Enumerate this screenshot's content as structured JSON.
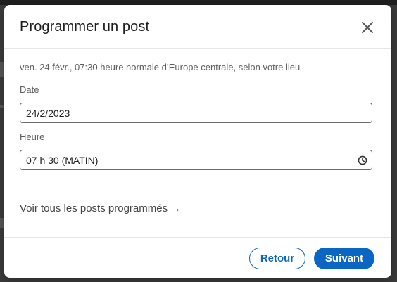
{
  "modal": {
    "title": "Programmer un post",
    "timezone_note": "ven. 24 févr., 07:30 heure normale d’Europe centrale, selon votre lieu",
    "date": {
      "label": "Date",
      "value": "24/2/2023"
    },
    "time": {
      "label": "Heure",
      "value": "07 h 30 (MATIN)"
    },
    "view_scheduled_link": "Voir tous les posts programmés",
    "view_scheduled_arrow": "→",
    "back_button": "Retour",
    "next_button": "Suivant"
  },
  "icons": {
    "close": "close-icon",
    "clock": "clock-icon",
    "arrow": "arrow-right-icon"
  },
  "colors": {
    "accent": "#0a66c2",
    "text_primary": "#1d1d1d",
    "text_secondary": "#5e5e5e"
  }
}
